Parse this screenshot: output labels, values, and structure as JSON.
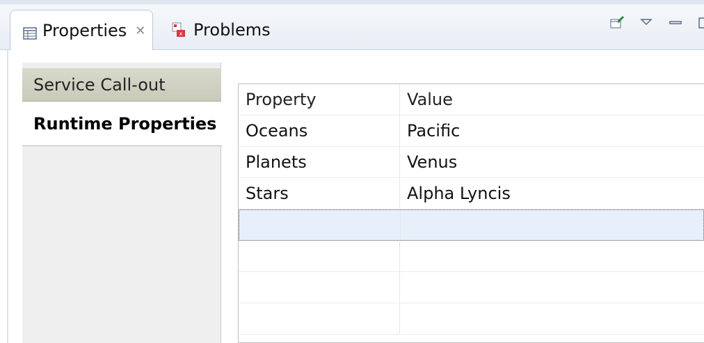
{
  "tabs": [
    {
      "label": "Properties",
      "icon": "properties-icon",
      "active": true
    },
    {
      "label": "Problems",
      "icon": "problems-icon",
      "active": false
    }
  ],
  "toolbar": {
    "icons": [
      "pin-edit-icon",
      "view-menu-icon",
      "minimize-icon",
      "maximize-icon"
    ]
  },
  "sidebar": {
    "items": [
      {
        "label": "Service Call-out",
        "selected": false
      },
      {
        "label": "Runtime Properties",
        "selected": true
      }
    ]
  },
  "table": {
    "headers": [
      "Property",
      "Value"
    ],
    "rows": [
      [
        "Oceans",
        "Pacific"
      ],
      [
        "Planets",
        "Venus"
      ],
      [
        "Stars",
        "Alpha Lyncis"
      ],
      [
        "",
        ""
      ],
      [
        "",
        ""
      ],
      [
        "",
        ""
      ],
      [
        "",
        ""
      ]
    ]
  },
  "colors": {
    "selected_row": "#e6effa",
    "sidebar_top": "#d1d2c2"
  }
}
